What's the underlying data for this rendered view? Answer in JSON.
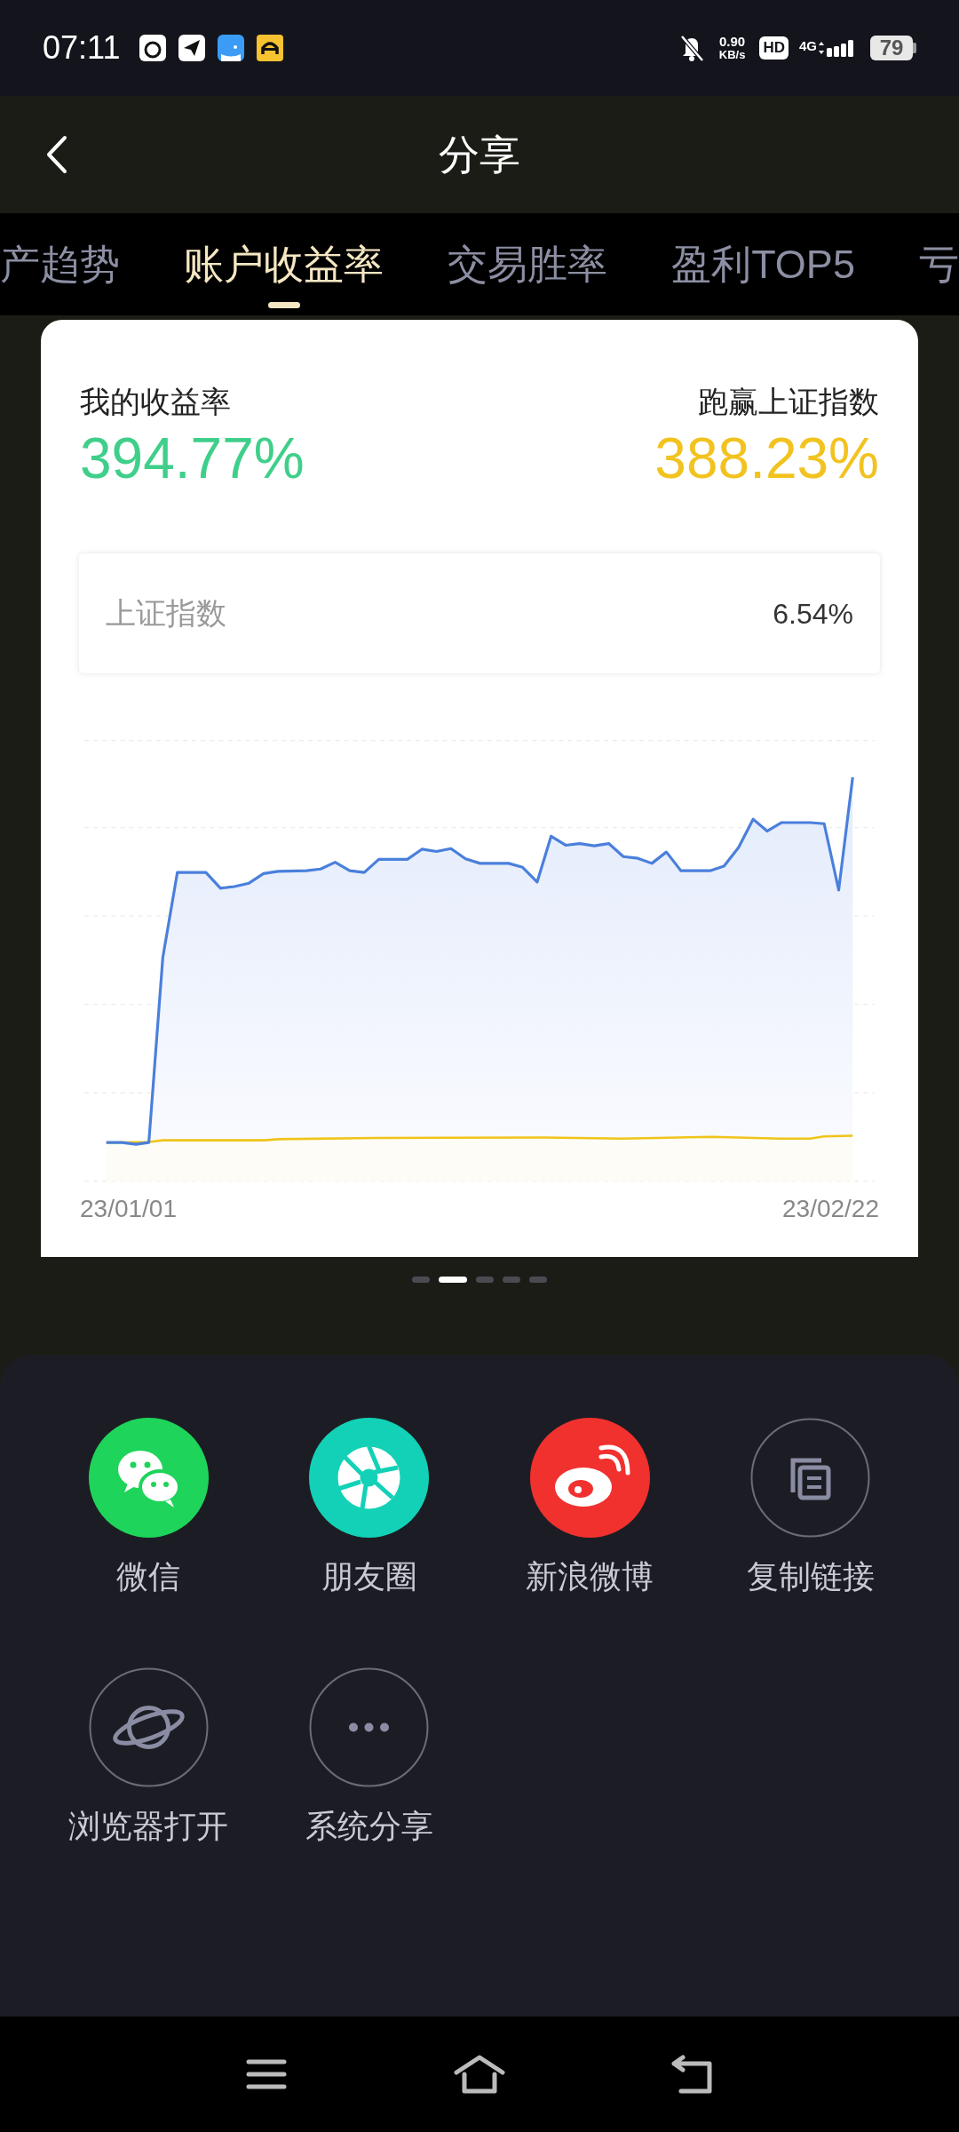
{
  "status_bar": {
    "time": "07:11",
    "net_speed": "0.90",
    "net_speed_unit": "KB/s",
    "hd": "HD",
    "network": "4G",
    "battery": "79"
  },
  "header": {
    "title": "分享"
  },
  "tabs": [
    {
      "label": "产趋势",
      "selected": false
    },
    {
      "label": "账户收益率",
      "selected": true
    },
    {
      "label": "交易胜率",
      "selected": false
    },
    {
      "label": "盈利TOP5",
      "selected": false
    },
    {
      "label": "亏",
      "selected": false
    }
  ],
  "card": {
    "my_return_label": "我的收益率",
    "my_return": "394.77%",
    "outperform_label": "跑赢上证指数",
    "outperform": "388.23%",
    "benchmark": {
      "label": "上证指数",
      "value": "6.54%"
    },
    "chart": {
      "start_label": "23/01/01",
      "end_label": "23/02/22"
    }
  },
  "pager": [
    {
      "selected": false
    },
    {
      "selected": true
    },
    {
      "selected": false
    },
    {
      "selected": false
    },
    {
      "selected": false
    }
  ],
  "share_options": [
    {
      "kind": "wechat",
      "label": "微信"
    },
    {
      "kind": "moments",
      "label": "朋友圈"
    },
    {
      "kind": "weibo",
      "label": "新浪微博"
    },
    {
      "kind": "copy",
      "label": "复制链接"
    },
    {
      "kind": "browser",
      "label": "浏览器打开"
    },
    {
      "kind": "system",
      "label": "系统分享"
    }
  ]
}
